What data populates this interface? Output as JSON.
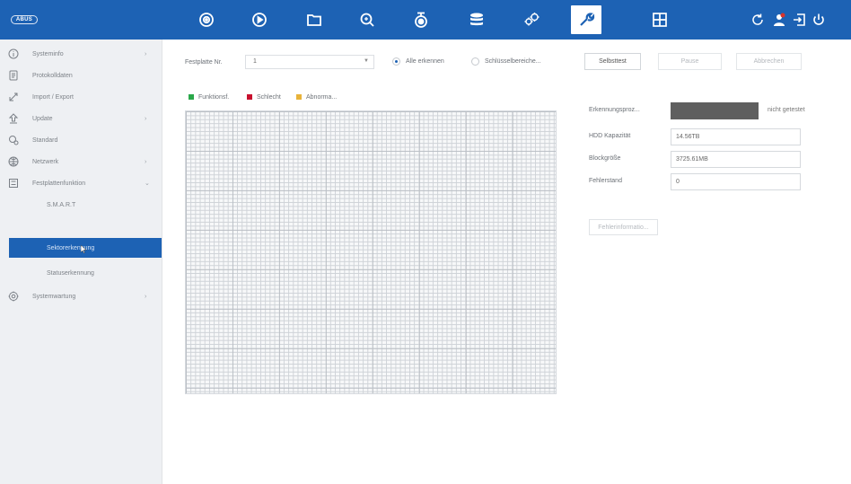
{
  "header": {
    "logo_text": "ABUS",
    "nav_icons": [
      "camera-icon",
      "play-icon",
      "folder-icon",
      "search-zoom-icon",
      "ptz-camera-icon",
      "database-icon",
      "gears-icon",
      "wrench-icon",
      "grid-icon"
    ],
    "active_nav": "wrench-icon",
    "right_icons": [
      "refresh-icon",
      "user-icon",
      "logout-icon",
      "power-icon"
    ],
    "bar_color": "#1d62b4"
  },
  "sidebar": {
    "items": [
      {
        "label": "Systeminfo",
        "icon": "info-icon",
        "chevron": "›"
      },
      {
        "label": "Protokolldaten",
        "icon": "document-icon",
        "chevron": ""
      },
      {
        "label": "Import / Export",
        "icon": "import-export-icon",
        "chevron": ""
      },
      {
        "label": "Update",
        "icon": "upload-icon",
        "chevron": "›"
      },
      {
        "label": "Standard",
        "icon": "defaults-icon",
        "chevron": ""
      },
      {
        "label": "Netzwerk",
        "icon": "network-icon",
        "chevron": "›"
      },
      {
        "label": "Festplattenfunktion",
        "icon": "hdd-icon",
        "chevron": "⌄"
      },
      {
        "label": "S.M.A.R.T",
        "sub": true
      },
      {
        "label": "Sektorerkennung",
        "sub": true,
        "active": true
      },
      {
        "label": "Statuserkennung",
        "sub": true
      },
      {
        "label": "Systemwartung",
        "icon": "maintenance-icon",
        "chevron": "›"
      }
    ]
  },
  "toolbar": {
    "disk_label": "Festplatte Nr.",
    "disk_value": "1",
    "radio_all": "Alle erkennen",
    "radio_key": "Schlüsselbereiche...",
    "btn_selftest": "Selbsttest",
    "btn_pause": "Pause",
    "btn_abort": "Abbrechen"
  },
  "legend": {
    "good": "Funktionsf.",
    "bad": "Schlecht",
    "abnormal": "Abnorma...",
    "good_color": "#2aa84a",
    "bad_color": "#c8102e",
    "abnormal_color": "#e8b33a"
  },
  "info": {
    "progress_label": "Erkennungsproz...",
    "progress_status": "nicht getestet",
    "progress_fraction": 1.0,
    "capacity_label": "HDD Kapazität",
    "capacity_value": "14.56TB",
    "block_label": "Blockgröße",
    "block_value": "3725.61MB",
    "error_label": "Fehlerstand",
    "error_value": "0",
    "error_info_button": "Fehlerinformatio..."
  }
}
